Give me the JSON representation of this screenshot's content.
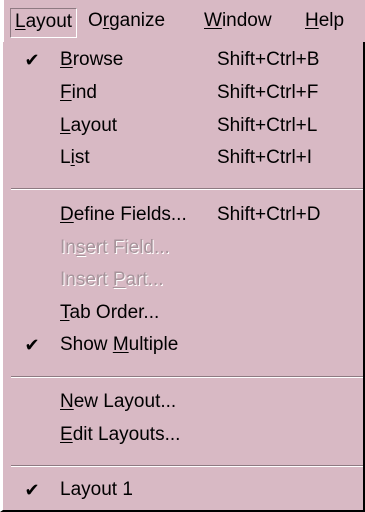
{
  "menubar": {
    "layout": {
      "pre": "",
      "key": "L",
      "post": "ayout"
    },
    "organize": {
      "pre": "O",
      "key": "r",
      "post": "ganize"
    },
    "window": {
      "pre": "",
      "key": "W",
      "post": "indow"
    },
    "help": {
      "pre": "",
      "key": "H",
      "post": "elp"
    }
  },
  "menu": {
    "browse": {
      "checked": "✔",
      "pre": "",
      "key": "B",
      "post": "rowse",
      "shortcut": "Shift+Ctrl+B"
    },
    "find": {
      "pre": "",
      "key": "F",
      "post": "ind",
      "shortcut": "Shift+Ctrl+F"
    },
    "layout": {
      "pre": "",
      "key": "L",
      "post": "ayout",
      "shortcut": "Shift+Ctrl+L"
    },
    "list": {
      "pre": "L",
      "key": "i",
      "post": "st",
      "shortcut": "Shift+Ctrl+I"
    },
    "define_fields": {
      "pre": "",
      "key": "D",
      "post": "efine Fields...",
      "shortcut": "Shift+Ctrl+D"
    },
    "insert_field": {
      "pre": "In",
      "key": "s",
      "post": "ert Field..."
    },
    "insert_part": {
      "pre": "Insert ",
      "key": "P",
      "post": "art..."
    },
    "tab_order": {
      "pre": "",
      "key": "T",
      "post": "ab Order..."
    },
    "show_multiple": {
      "checked": "✔",
      "pre": "Show ",
      "key": "M",
      "post": "ultiple"
    },
    "new_layout": {
      "pre": "",
      "key": "N",
      "post": "ew Layout..."
    },
    "edit_layouts": {
      "pre": "",
      "key": "E",
      "post": "dit Layouts..."
    },
    "layout_1": {
      "checked": "✔",
      "pre": "Layout 1",
      "key": "",
      "post": ""
    }
  },
  "colors": {
    "menu_bg": "#d8b9c4",
    "disabled_text": "#a7949b",
    "separator_shadow": "#8e7a82"
  }
}
